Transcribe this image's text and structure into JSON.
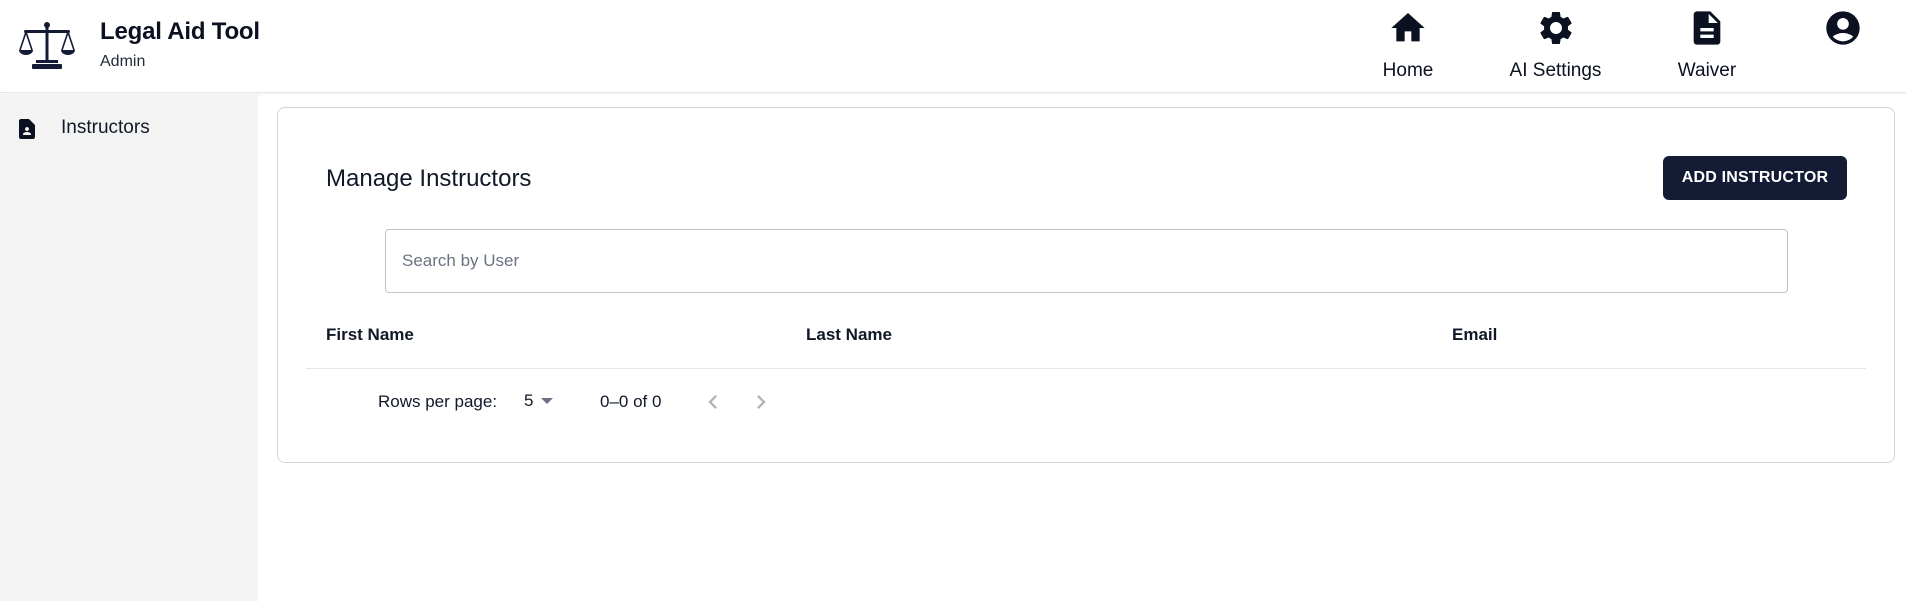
{
  "app": {
    "title": "Legal Aid Tool",
    "role": "Admin"
  },
  "nav": {
    "items": [
      {
        "label": "Home",
        "icon": "home-icon"
      },
      {
        "label": "AI Settings",
        "icon": "gear-icon"
      },
      {
        "label": "Waiver",
        "icon": "document-icon"
      }
    ],
    "profile_icon": "account-circle-icon"
  },
  "sidebar": {
    "items": [
      {
        "label": "Instructors",
        "icon": "contact-document-icon"
      }
    ]
  },
  "main": {
    "title": "Manage Instructors",
    "add_button": "ADD INSTRUCTOR",
    "search_placeholder": "Search by User",
    "table": {
      "columns": [
        "First Name",
        "Last Name",
        "Email"
      ],
      "rows": []
    },
    "pagination": {
      "rows_per_page_label": "Rows per page:",
      "rows_per_page": "5",
      "range": "0–0 of 0"
    }
  },
  "colors": {
    "primary": "#141b35",
    "sidebar_bg": "#f3f3f3",
    "icon": "#0b1120"
  }
}
